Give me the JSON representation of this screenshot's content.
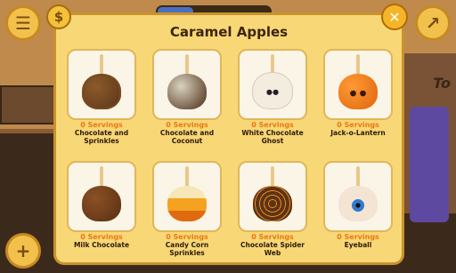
{
  "hud": {
    "menu_icon": "menu-icon",
    "coin_symbol": "$",
    "close_symbol": "✕",
    "top_right_icon": "trend-icon",
    "add_symbol": "+",
    "corner_text": "To"
  },
  "modal": {
    "title": "Caramel Apples"
  },
  "items": [
    {
      "servings": "0 Servings",
      "name": "Chocolate and Sprinkles",
      "apple_color": "#5a3417",
      "topping_color": "#7a4a20"
    },
    {
      "servings": "0 Servings",
      "name": "Chocolate and Coconut",
      "apple_color": "#4a2b14",
      "topping_color": "#d9d2c0"
    },
    {
      "servings": "0 Servings",
      "name": "White Chocolate Ghost",
      "apple_color": "#f3ecdf",
      "topping_color": "#8dbd3a"
    },
    {
      "servings": "0 Servings",
      "name": "Jack-o-Lantern",
      "apple_color": "#f07a14",
      "topping_color": "#d86510"
    },
    {
      "servings": "0 Servings",
      "name": "Milk Chocolate",
      "apple_color": "#6b3b18",
      "topping_color": "#8dbd3a"
    },
    {
      "servings": "0 Servings",
      "name": "Candy Corn Sprinkles",
      "apple_color": "#f4a21f",
      "topping_color": "#f7e6b6"
    },
    {
      "servings": "0 Servings",
      "name": "Chocolate Spider Web",
      "apple_color": "#5b3416",
      "topping_color": "#f08a1a"
    },
    {
      "servings": "0 Servings",
      "name": "Eyeball",
      "apple_color": "#f3e4d4",
      "topping_color": "#d44"
    }
  ]
}
